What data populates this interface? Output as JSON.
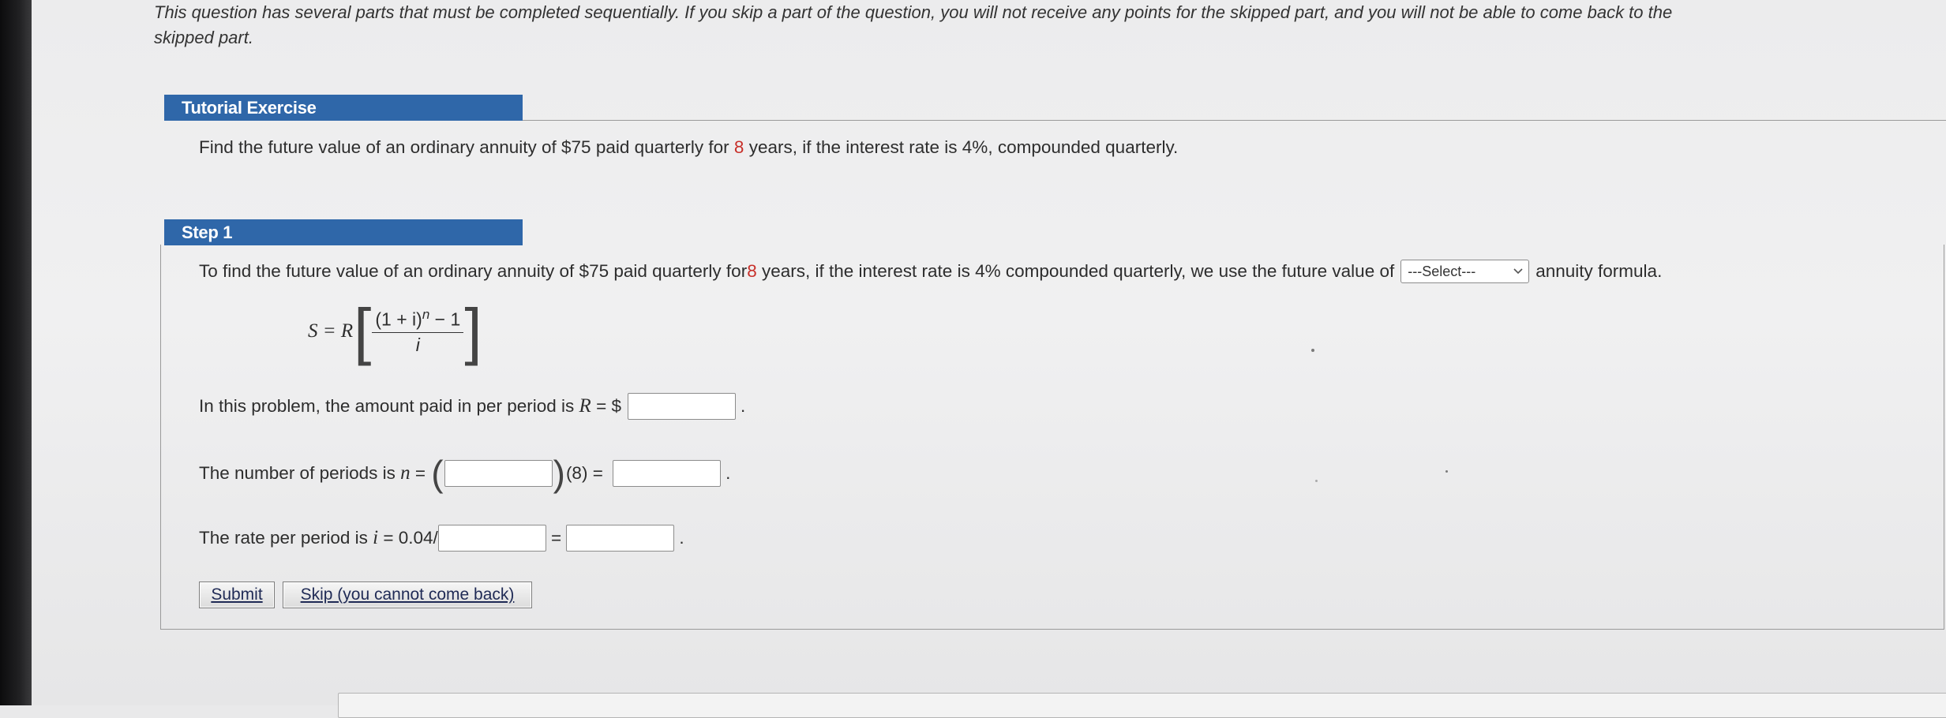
{
  "intro": {
    "line1": "This question has several parts that must be completed sequentially. If you skip a part of the question, you will not receive any points for the skipped part, and you will not be able to come back to the",
    "line2": "skipped part."
  },
  "tutorial": {
    "header": "Tutorial Exercise",
    "problem_pre": "Find the future value of an ordinary annuity of $75 paid quarterly for ",
    "problem_years": "8",
    "problem_post": " years, if the interest rate is 4%, compounded quarterly."
  },
  "step1": {
    "header": "Step 1",
    "intro_pre": "To find the future value of an ordinary annuity of $75 paid quarterly for ",
    "intro_years": "8",
    "intro_mid": " years, if the interest rate is 4% compounded quarterly, we use the future value of",
    "select_value": "---Select---",
    "intro_post": "annuity formula.",
    "formula": {
      "lhs": "S = R",
      "numerator": "(1 + i)",
      "exponent": "n",
      "numerator_tail": " − 1",
      "denominator": "i"
    },
    "r_line_pre": "In this problem, the amount paid in per period is ",
    "r_var": "R",
    "r_eq": " = $",
    "r_value": "",
    "n_line_pre": "The number of periods is ",
    "n_var": "n",
    "n_eq": " = ",
    "n_factor_value": "",
    "n_mult": "(8) = ",
    "n_value": "",
    "i_line_pre": "The rate per period is ",
    "i_var": "i",
    "i_eq": " = 0.04/",
    "i_divisor_value": "",
    "i_equals": " = ",
    "i_value": "",
    "period": "."
  },
  "buttons": {
    "submit": "Submit",
    "skip": "Skip (you cannot come back)"
  },
  "colors": {
    "header_bar": "#2f67a9",
    "highlight_number": "#c8302a"
  }
}
